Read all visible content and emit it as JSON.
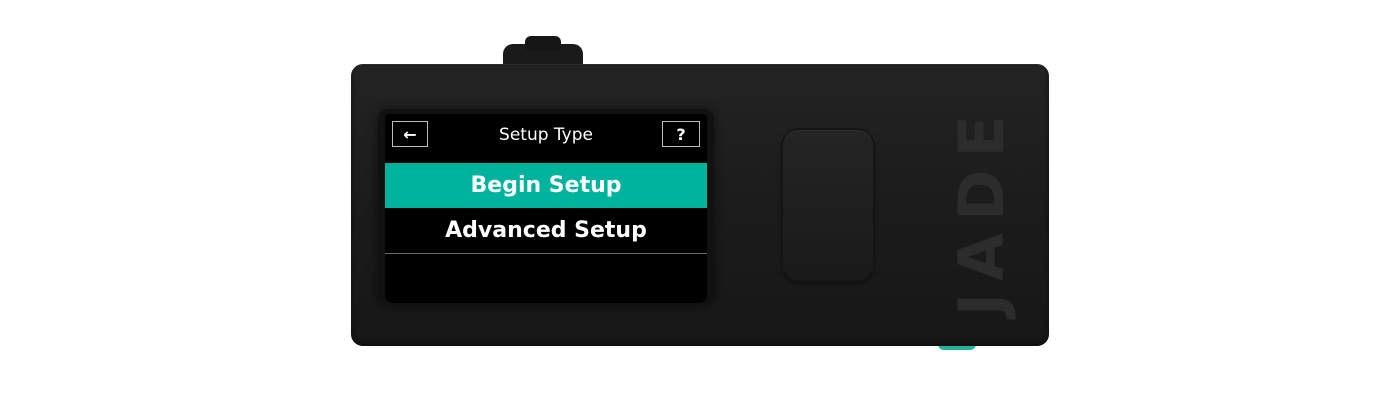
{
  "device": {
    "brand": "JADE"
  },
  "screen": {
    "title": "Setup Type",
    "back_icon": "←",
    "help_label": "?",
    "menu": [
      {
        "label": "Begin Setup",
        "selected": true
      },
      {
        "label": "Advanced Setup",
        "selected": false
      }
    ]
  },
  "colors": {
    "accent": "#00b39c",
    "screen_bg": "#000000",
    "device_body": "#1d1d1d"
  }
}
